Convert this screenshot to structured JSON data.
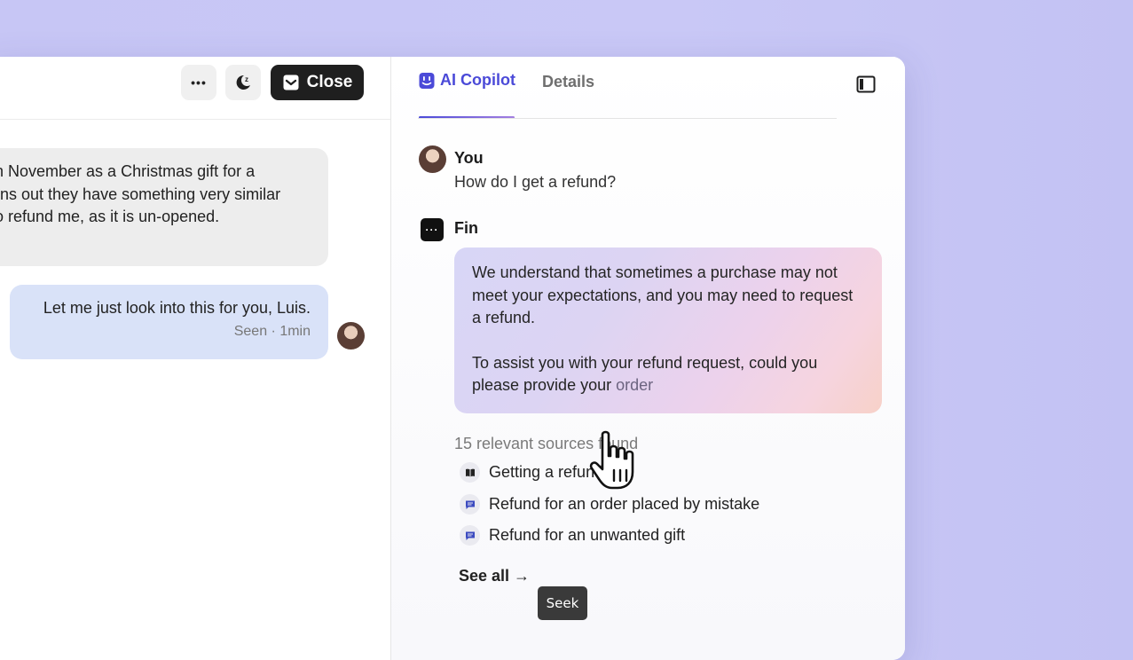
{
  "header": {
    "more_label": "•••",
    "close_label": "Close"
  },
  "conversation": {
    "customer_message_lines": [
      "n November as a Christmas gift for a",
      "rns out they have something very similar",
      "o refund me, as it is un-opened."
    ],
    "agent_message": "Let me just look into this for you, Luis.",
    "agent_meta": "Seen · 1min"
  },
  "copilot": {
    "tabs": {
      "ai_copilot": "AI Copilot",
      "details": "Details"
    },
    "user_name": "You",
    "user_question": "How do I get a refund?",
    "bot_name": "Fin",
    "bot_icon_text": "···",
    "answer_p1": "We understand that sometimes a purchase may not meet your expectations, and you may need to request a refund.",
    "answer_p2": "To assist you with your refund request, could you please provide your",
    "answer_p2_fade": "order",
    "sources_count": "15 relevant sources found",
    "sources": [
      {
        "label": "Getting a refund",
        "icon": "book-icon"
      },
      {
        "label": "Refund for an order placed by mistake",
        "icon": "chat-icon"
      },
      {
        "label": "Refund for an unwanted gift",
        "icon": "chat-icon"
      }
    ],
    "see_all": "See all →"
  },
  "tooltip": {
    "seek": "Seek"
  },
  "colors": {
    "accent": "#4b4ad8",
    "background": "#c7c6f5"
  }
}
